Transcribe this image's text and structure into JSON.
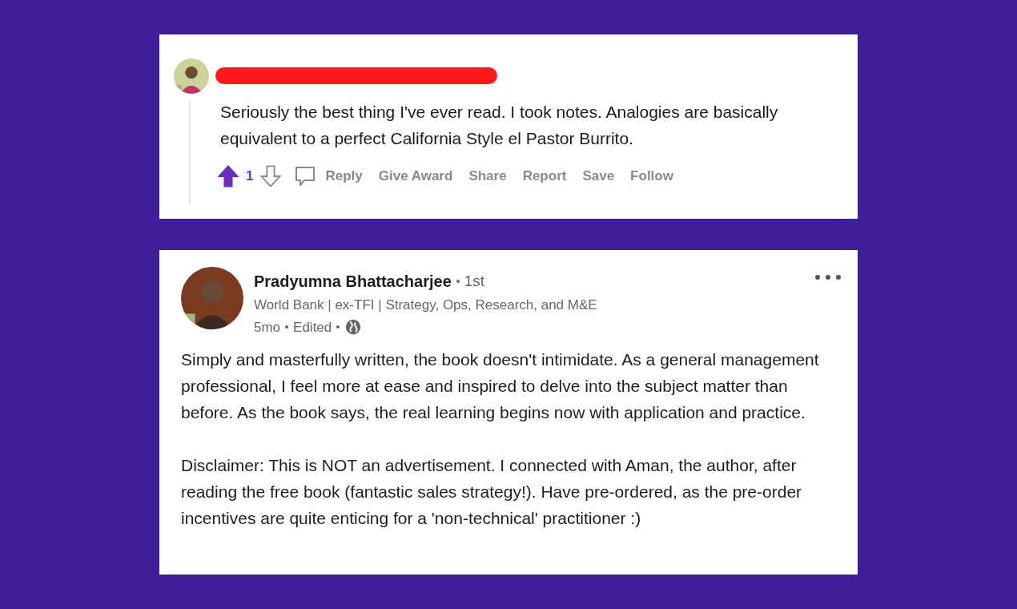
{
  "reddit_comment": {
    "username_redacted": true,
    "body": "Seriously the best thing I've ever read. I took notes. Analogies are basically equivalent to a perfect California Style el Pastor Burrito.",
    "upvoted": true,
    "score": "1",
    "actions": [
      "Reply",
      "Give Award",
      "Share",
      "Report",
      "Save",
      "Follow"
    ]
  },
  "linkedin_comment": {
    "name": "Pradyumna Bhattacharjee",
    "degree": "1st",
    "headline": "World Bank | ex-TFI | Strategy, Ops, Research, and M&E",
    "time": "5mo",
    "edited": "Edited",
    "paragraphs": [
      "Simply and masterfully written, the book doesn't intimidate. As a general management professional, I feel more at ease and inspired to delve into the subject matter than before. As the book says, the real learning begins now with application and practice.",
      "Disclaimer: This is NOT an advertisement. I connected with Aman, the author, after reading the free book (fantastic sales strategy!). Have pre-ordered, as the pre-order incentives are quite enticing for a 'non-technical' practitioner :)"
    ]
  }
}
